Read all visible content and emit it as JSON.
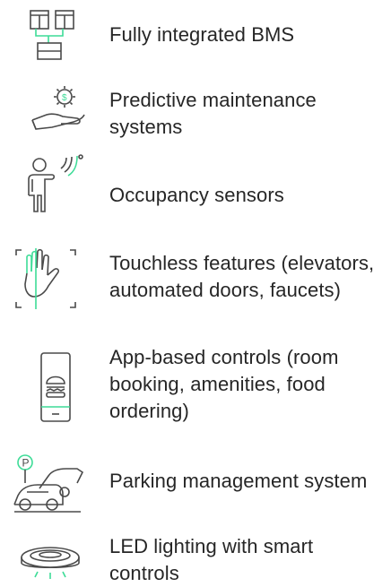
{
  "colors": {
    "icon_stroke": "#4a4a4a",
    "accent": "#3ddc97",
    "text": "#262626"
  },
  "features": [
    {
      "label": "Fully integrated BMS",
      "icon": "bms-network-icon"
    },
    {
      "label": "Predictive maintenance systems",
      "icon": "gear-hand-icon"
    },
    {
      "label": "Occupancy sensors",
      "icon": "person-sensor-icon"
    },
    {
      "label": "Touchless features (elevators, automated doors, faucets)",
      "icon": "touchless-hand-icon"
    },
    {
      "label": "App-based controls (room booking, amenities, food ordering)",
      "icon": "phone-app-icon"
    },
    {
      "label": "Parking management system",
      "icon": "parking-cars-icon"
    },
    {
      "label": "LED lighting with smart controls",
      "icon": "led-light-icon"
    }
  ]
}
